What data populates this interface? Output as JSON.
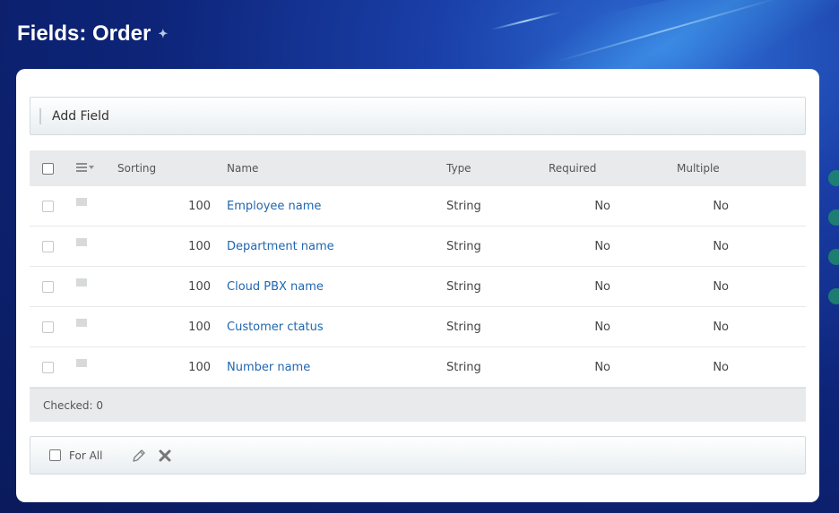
{
  "page": {
    "title": "Fields: Order"
  },
  "toolbar": {
    "add_field_label": "Add Field"
  },
  "grid": {
    "columns": {
      "sorting": "Sorting",
      "name": "Name",
      "type": "Type",
      "required": "Required",
      "multiple": "Multiple"
    },
    "rows": [
      {
        "sorting": "100",
        "name": "Employee name",
        "type": "String",
        "required": "No",
        "multiple": "No"
      },
      {
        "sorting": "100",
        "name": "Department name",
        "type": "String",
        "required": "No",
        "multiple": "No"
      },
      {
        "sorting": "100",
        "name": "Cloud PBX name",
        "type": "String",
        "required": "No",
        "multiple": "No"
      },
      {
        "sorting": "100",
        "name": "Customer ctatus",
        "type": "String",
        "required": "No",
        "multiple": "No"
      },
      {
        "sorting": "100",
        "name": "Number name",
        "type": "String",
        "required": "No",
        "multiple": "No"
      }
    ],
    "checked_label": "Checked: 0"
  },
  "actions": {
    "for_all_label": "For All",
    "edit_icon": "pencil-icon",
    "delete_icon": "cross-icon"
  },
  "colors": {
    "link": "#2067b0",
    "background": "#0d2478"
  }
}
